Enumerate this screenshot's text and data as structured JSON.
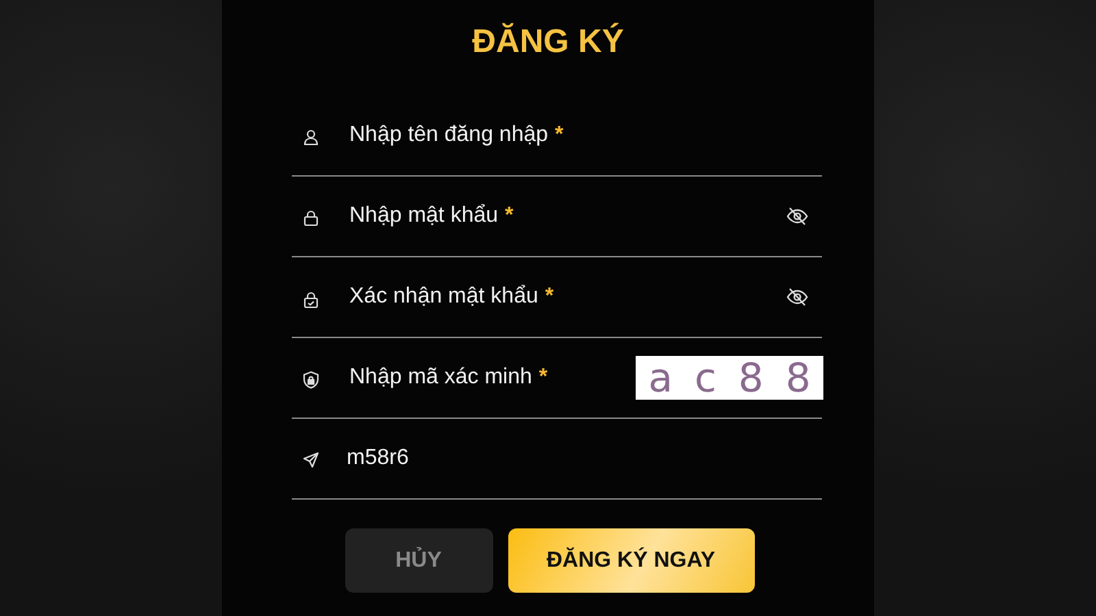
{
  "title": "ĐĂNG KÝ",
  "fields": [
    {
      "kind": "user",
      "placeholder": "Nhập tên đăng nhập",
      "required_mark": "*"
    },
    {
      "kind": "password",
      "placeholder": "Nhập mật khẩu",
      "required_mark": "*",
      "eye": true
    },
    {
      "kind": "confirm",
      "placeholder": "Xác nhận mật khẩu",
      "required_mark": "*",
      "eye": true
    },
    {
      "kind": "captcha",
      "placeholder": "Nhập mã xác minh",
      "required_mark": "*",
      "captcha": "ac88"
    },
    {
      "kind": "code",
      "value": "m58r6"
    }
  ],
  "buttons": [
    {
      "kind": "cancel",
      "label": "HỦY"
    },
    {
      "kind": "submit",
      "label": "ĐĂNG KÝ NGAY"
    }
  ]
}
